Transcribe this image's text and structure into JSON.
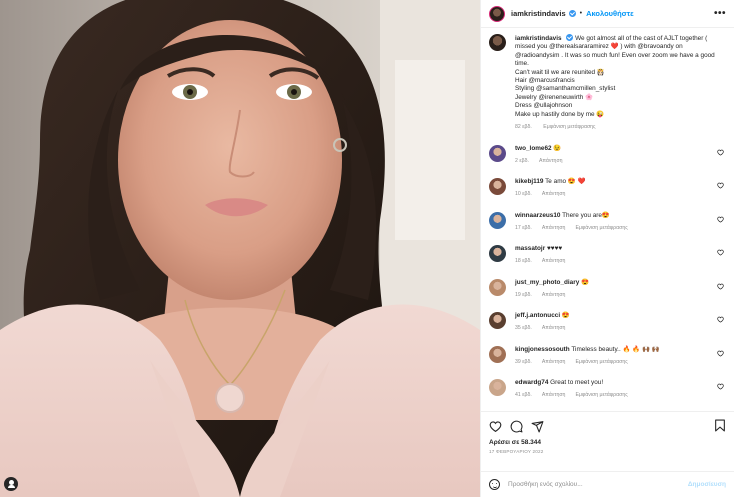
{
  "header": {
    "username": "iamkristindavis",
    "separator": "•",
    "follow_label": "Ακολουθήστε",
    "more_label": "•••"
  },
  "caption": {
    "username": "iamkristindavis",
    "lines": [
      "We got almost all of the cast of AJLT together ( missed you @therealsararamirez ❤️ ) with @bravoandy on @radioandysim . It was so much fun! Even over zoom we have a good time.",
      "Can't wait til we are reunited 👸🏻",
      "Hair @marcusfrancis",
      "Styling @samanthamcmillen_stylist",
      "Jewelry @ireneneuwirth 🌸",
      "Dress @ullajohnson",
      "Make up hastily done by me 😜"
    ],
    "time": "82 εβδ.",
    "translate": "Εμφάνιση μετάφρασης"
  },
  "comments": [
    {
      "user": "two_lome62",
      "text": "😉",
      "time": "2 εβδ.",
      "reply": "Απάντηση",
      "translate": ""
    },
    {
      "user": "kikebj119",
      "text": "Te amo 😍 ❤️",
      "time": "10 εβδ.",
      "reply": "Απάντηση",
      "translate": ""
    },
    {
      "user": "winnaarzeus10",
      "text": "There you are😍",
      "time": "17 εβδ.",
      "reply": "Απάντηση",
      "translate": "Εμφάνιση μετάφρασης"
    },
    {
      "user": "massatojr",
      "text": "♥♥♥♥",
      "time": "18 εβδ.",
      "reply": "Απάντηση",
      "translate": ""
    },
    {
      "user": "just_my_photo_diary",
      "text": "😍",
      "time": "19 εβδ.",
      "reply": "Απάντηση",
      "translate": ""
    },
    {
      "user": "jeff.j.antonucci",
      "text": "😍",
      "time": "35 εβδ.",
      "reply": "Απάντηση",
      "translate": ""
    },
    {
      "user": "kingjonessosouth",
      "text": "Timeless beauty.. 🔥 🔥 🙌🏾 🙌🏾",
      "time": "39 εβδ.",
      "reply": "Απάντηση",
      "translate": "Εμφάνιση μετάφρασης"
    },
    {
      "user": "edwardg74",
      "text": "Great to meet you!",
      "time": "41 εβδ.",
      "reply": "Απάντηση",
      "translate": "Εμφάνιση μετάφρασης"
    }
  ],
  "actions": {
    "likes": "Αρέσει σε 58.344",
    "date": "17 ΦΕΒΡΟΥΑΡΙΟΥ 2022"
  },
  "add_comment": {
    "placeholder": "Προσθήκη ενός σχολίου...",
    "post_label": "Δημοσίευση"
  },
  "colors": {
    "accent": "#0095f6",
    "verified": "#3897f0",
    "muted": "#8e8e8e"
  },
  "icons": [
    "user-tag-icon",
    "verified-icon",
    "more-icon",
    "heart-icon",
    "comment-icon",
    "share-icon",
    "bookmark-icon",
    "emoji-icon"
  ]
}
